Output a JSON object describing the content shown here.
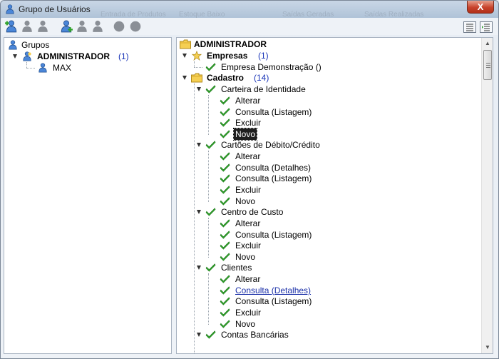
{
  "window": {
    "title": "Grupo de Usuários",
    "close_label": "X"
  },
  "background_ghost": [
    "Entrada de Produtos",
    "Estoque Baixo",
    "Saídas Geradas",
    "Saídas Realizadas"
  ],
  "toolbar": {
    "left_icons": [
      "add-group-icon",
      "group-icon",
      "group-icon",
      "add-user-icon",
      "user-icon",
      "user-icon",
      "circle-icon",
      "circle-icon"
    ],
    "right_icons": [
      "list-view-icon",
      "detail-view-icon"
    ]
  },
  "groups_tree": {
    "root_label": "Grupos",
    "group": {
      "name": "ADMINISTRADOR",
      "count": "(1)"
    },
    "user": "MAX"
  },
  "permissions_tree": {
    "root_label": "ADMINISTRADOR",
    "empresas": {
      "label": "Empresas",
      "count": "(1)",
      "items": [
        "Empresa Demonstração ()"
      ]
    },
    "cadastro": {
      "label": "Cadastro",
      "count": "(14)",
      "carteira": {
        "label": "Carteira de Identidade",
        "items": [
          "Alterar",
          "Consulta (Listagem)",
          "Excluir",
          "Novo"
        ]
      },
      "cartoes": {
        "label": "Cartões de Débito/Crédito",
        "items": [
          "Alterar",
          "Consulta (Detalhes)",
          "Consulta (Listagem)",
          "Excluir",
          "Novo"
        ]
      },
      "centro": {
        "label": "Centro de Custo",
        "items": [
          "Alterar",
          "Consulta (Listagem)",
          "Excluir",
          "Novo"
        ]
      },
      "clientes": {
        "label": "Clientes",
        "items": [
          "Alterar",
          "Consulta (Detalhes)",
          "Consulta (Listagem)",
          "Excluir",
          "Novo"
        ]
      },
      "contas": {
        "label": "Contas Bancárias"
      }
    }
  }
}
